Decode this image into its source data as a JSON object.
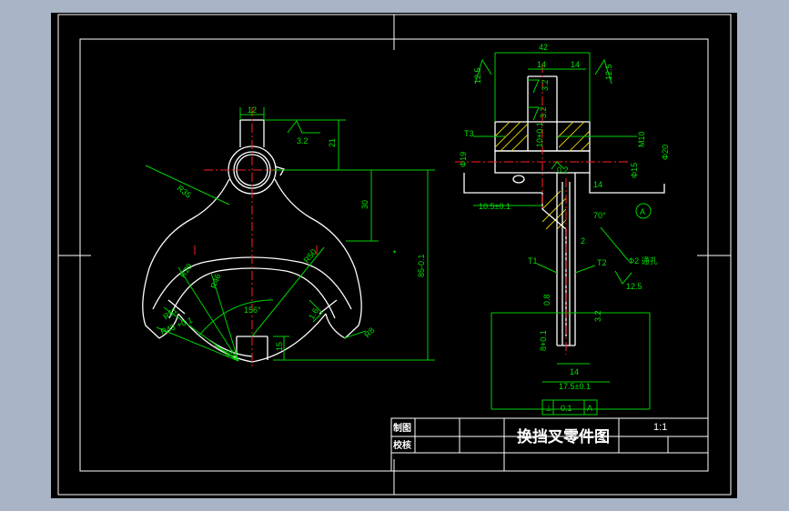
{
  "drawing": {
    "title": "换挡叉零件图",
    "scale": "1:1",
    "table": {
      "draw_label": "制图",
      "check_label": "校核"
    }
  },
  "dims": {
    "d_12": "12",
    "d_3_2a": "3.2",
    "d_21": "21",
    "d_r35": "R35",
    "d_30": "30",
    "d_85": "85-0.1",
    "d_r50": "R50",
    "d_r46": "R46",
    "d_r51": "R51",
    "d_r43": "R43 +0.1",
    "d_r29": "R29",
    "d_156": "156°",
    "d_15": "15",
    "d_1_6": "1.6",
    "d_r8": "R8",
    "d_35": "35°",
    "s_42": "42",
    "s_14a": "14",
    "s_14b": "14",
    "s_12_5a": "12.5",
    "s_12_5b": "12.5",
    "s_3_2a": "3.2",
    "s_3_2b": "3.2",
    "s_t3": "T3",
    "s_10": "10+0.1",
    "s_m10": "M10",
    "s_d19": "Φ19",
    "s_d15": "Φ15",
    "s_d20": "Φ20",
    "s_02": "0.2",
    "s_14c": "14",
    "s_10_5": "10.5±0.1",
    "s_70": "70°",
    "s_a": "A",
    "s_2": "2",
    "s_t1": "T1",
    "s_t2": "T2",
    "s_hole": "Φ2 通孔",
    "s_12_5c": "12.5",
    "s_0_8": "0.8",
    "s_3_2c": "3.2",
    "s_8": "8+0.1",
    "s_14d": "14",
    "s_17_5": "17.5±0.1",
    "s_tol_sym": "⊥",
    "s_tol_val": "0.1",
    "s_tol_ref": "A"
  }
}
